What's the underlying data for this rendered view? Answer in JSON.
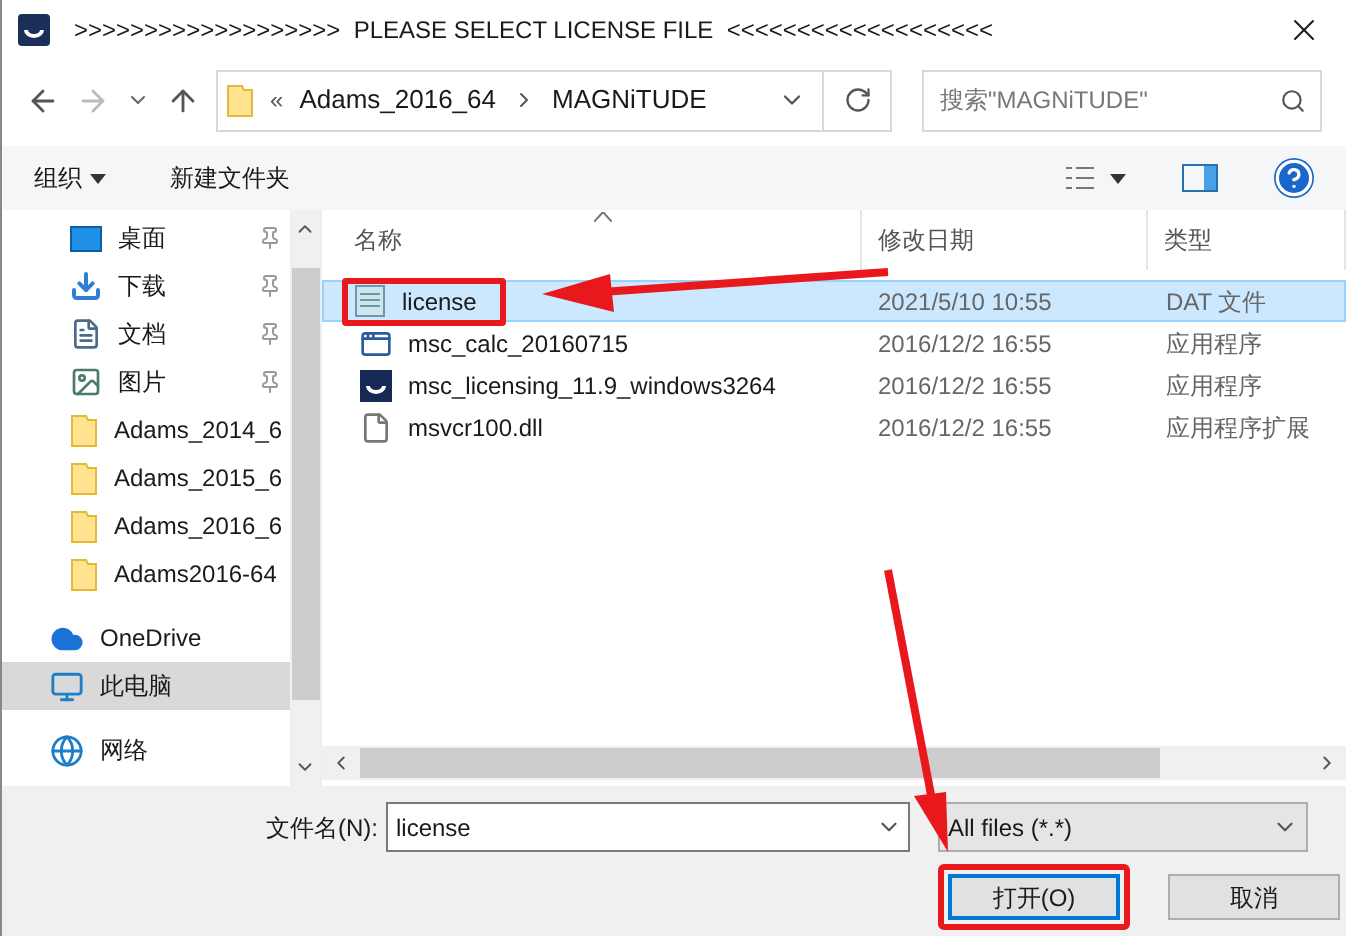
{
  "window": {
    "title": ">>>>>>>>>>>>>>>>>>>  PLEASE SELECT LICENSE FILE  <<<<<<<<<<<<<<<<<<<"
  },
  "address": {
    "prefix": "«",
    "path": [
      "Adams_2016_64",
      "MAGNiTUDE"
    ]
  },
  "search": {
    "placeholder": "搜索\"MAGNiTUDE\""
  },
  "toolbar": [
    "组织",
    "新建文件夹"
  ],
  "sidebar": [
    {
      "label": "桌面",
      "kind": "desktop",
      "pinned": true,
      "selected": false
    },
    {
      "label": "下载",
      "kind": "downloads",
      "pinned": true,
      "selected": false
    },
    {
      "label": "文档",
      "kind": "documents",
      "pinned": true,
      "selected": false
    },
    {
      "label": "图片",
      "kind": "pictures",
      "pinned": true,
      "selected": false
    },
    {
      "label": "Adams_2014_6",
      "kind": "folder",
      "pinned": false,
      "selected": false
    },
    {
      "label": "Adams_2015_6",
      "kind": "folder",
      "pinned": false,
      "selected": false
    },
    {
      "label": "Adams_2016_6",
      "kind": "folder",
      "pinned": false,
      "selected": false
    },
    {
      "label": "Adams2016-64",
      "kind": "folder",
      "pinned": false,
      "selected": false
    },
    {
      "label": "OneDrive",
      "kind": "cloud",
      "pinned": false,
      "selected": false
    },
    {
      "label": "此电脑",
      "kind": "computer",
      "pinned": false,
      "selected": true
    },
    {
      "label": "网络",
      "kind": "network",
      "pinned": false,
      "selected": false
    }
  ],
  "table": {
    "columns": [
      "名称",
      "修改日期",
      "类型"
    ],
    "rows": [
      {
        "name": "license",
        "date": "2021/5/10 10:55",
        "type": "DAT 文件",
        "kind": "text",
        "selected": true,
        "highlighted": true
      },
      {
        "name": "msc_calc_20160715",
        "date": "2016/12/2 16:55",
        "type": "应用程序",
        "kind": "app",
        "selected": false,
        "highlighted": false
      },
      {
        "name": "msc_licensing_11.9_windows3264",
        "date": "2016/12/2 16:55",
        "type": "应用程序",
        "kind": "installer",
        "selected": false,
        "highlighted": false
      },
      {
        "name": "msvcr100.dll",
        "date": "2016/12/2 16:55",
        "type": "应用程序扩展",
        "kind": "dll",
        "selected": false,
        "highlighted": false
      }
    ]
  },
  "file_name": {
    "label": "文件名(N):",
    "value": "license"
  },
  "file_type": {
    "value": "All files (*.*)"
  },
  "buttons": [
    {
      "label": "打开(O)",
      "kind": "primary",
      "highlighted": true
    },
    {
      "label": "取消",
      "kind": "secondary",
      "highlighted": false
    }
  ]
}
